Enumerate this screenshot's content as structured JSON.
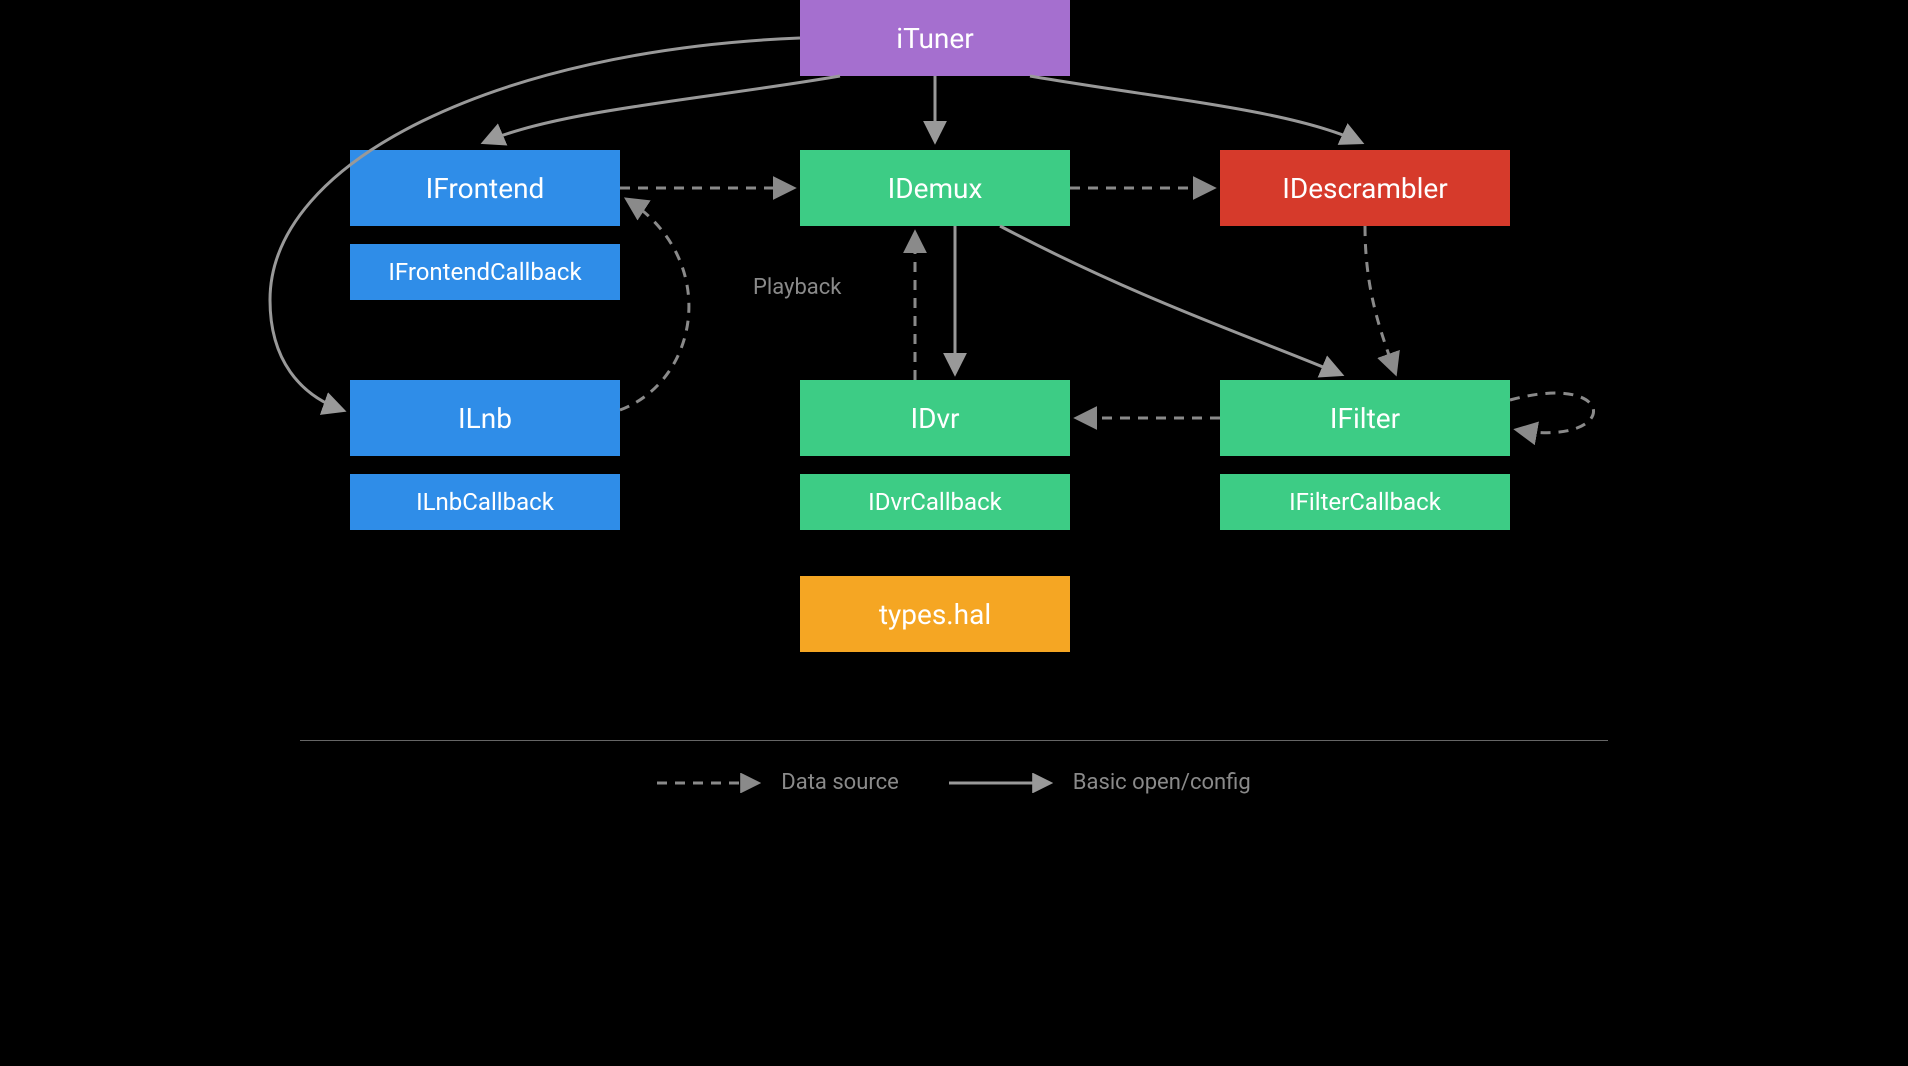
{
  "nodes": {
    "ituner": "iTuner",
    "ifrontend": "IFrontend",
    "ifrontendcallback": "IFrontendCallback",
    "idemux": "IDemux",
    "idescrambler": "IDescrambler",
    "ilnb": "ILnb",
    "ilnbcallback": "ILnbCallback",
    "idvr": "IDvr",
    "idvrcallback": "IDvrCallback",
    "ifilter": "IFilter",
    "ifiltercallback": "IFilterCallback",
    "typeshal": "types.hal"
  },
  "labels": {
    "playback": "Playback"
  },
  "legend": {
    "dashed": "Data source",
    "solid": "Basic open/config"
  },
  "colors": {
    "purple": "#a56fcf",
    "blue": "#2f8de8",
    "green": "#3dcc85",
    "red": "#d63a2b",
    "orange": "#f5a623",
    "arrow": "#999999",
    "dashed": "#8a8a8a"
  }
}
